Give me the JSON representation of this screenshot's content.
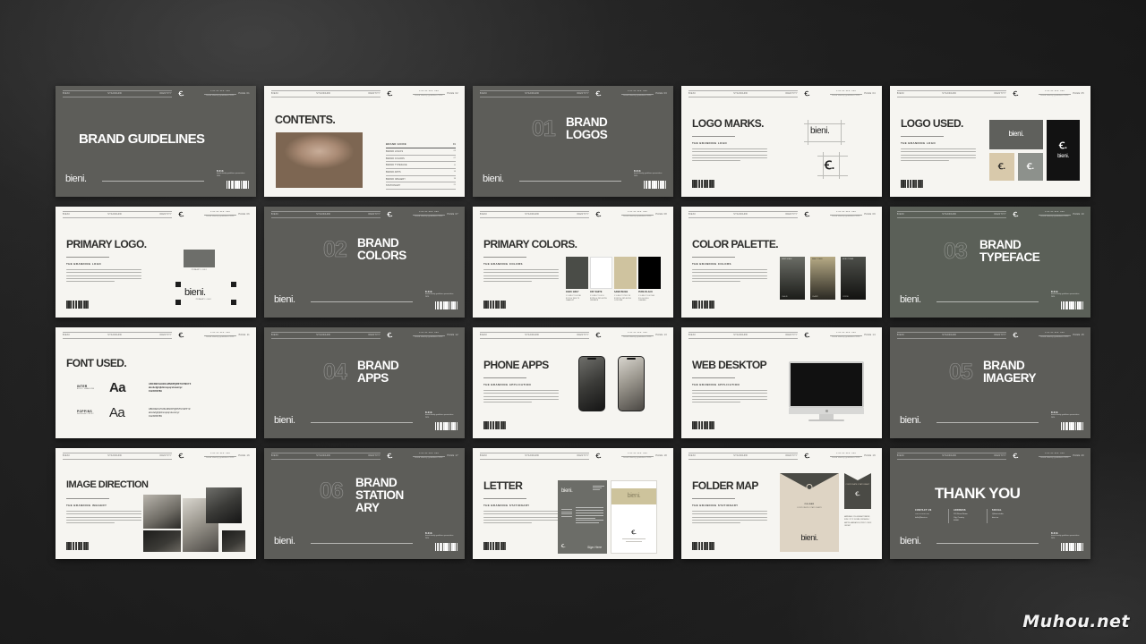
{
  "watermark": "Muhou.net",
  "brand": {
    "name": "bieni.",
    "mark": "Ꞓ.",
    "tagline": "BRAND GUIDELINES"
  },
  "header": {
    "nav": [
      "BIENI",
      "STANDARD",
      "IDENTITY"
    ],
    "meta_line1": "V.01 01 DIS. 000",
    "meta_line2": "brand identity guidelines 2024",
    "page_prefix": "PAGE"
  },
  "footer_meta": {
    "title": "B.R.D.",
    "sub": "brand identity guidelines presentation 2024"
  },
  "slides": [
    {
      "id": "brand-guidelines",
      "type": "cover",
      "theme": "dark",
      "page": "PAGE 01",
      "title": "BRAND GUIDELINES",
      "brand": "bieni."
    },
    {
      "id": "contents",
      "type": "contents",
      "theme": "light",
      "page": "PAGE 02",
      "title": "CONTENTS.",
      "toc_head": {
        "label": "BRAND GUIDE",
        "page": "01"
      },
      "toc": [
        {
          "label": "BRAND LOGOS",
          "page": "03"
        },
        {
          "label": "BRAND COLORS",
          "page": "07"
        },
        {
          "label": "BRAND TYPEFACE",
          "page": "11"
        },
        {
          "label": "BRAND APPS",
          "page": "14"
        },
        {
          "label": "BRAND IMAGERY",
          "page": "18"
        },
        {
          "label": "STATIONARY",
          "page": "21"
        }
      ]
    },
    {
      "id": "brand-logos",
      "type": "section",
      "theme": "dark",
      "page": "PAGE 03",
      "number": "01",
      "title_l1": "BRAND",
      "title_l2": "LOGOS",
      "brand": "bieni."
    },
    {
      "id": "logo-marks",
      "type": "content",
      "theme": "light",
      "page": "PAGE 04",
      "title": "LOGO MARKS.",
      "kicker": "THE BRANDING LOGO",
      "wordmark": "bieni.",
      "monogram": "Ꞓ."
    },
    {
      "id": "logo-used",
      "type": "content",
      "theme": "light",
      "page": "PAGE 05",
      "title": "LOGO USED.",
      "kicker": "THE BRANDING LOGO",
      "swatch_colors": [
        "#5f605c",
        "#d8c9ab",
        "#8d918c",
        "#121212"
      ],
      "wordmark": "bieni.",
      "monogram": "Ꞓ."
    },
    {
      "id": "primary-logo",
      "type": "content",
      "theme": "light",
      "page": "PAGE 06",
      "title": "PRIMARY LOGO.",
      "kicker": "THE BRANDING LOGO",
      "wordmark": "bieni.",
      "caption_a": "PRIMARY LOGO",
      "caption_b": "PRIMARY LOGO"
    },
    {
      "id": "brand-colors",
      "type": "section",
      "theme": "dark",
      "page": "PAGE 07",
      "number": "02",
      "title_l1": "BRAND",
      "title_l2": "COLORS",
      "brand": "bieni."
    },
    {
      "id": "primary-colors",
      "type": "colors",
      "theme": "light",
      "page": "PAGE 08",
      "title": "PRIMARY COLORS.",
      "kicker": "THE BRANDING COLORS",
      "swatches": [
        {
          "name": "DARK GREY",
          "hex": "#4A4C47",
          "cmyk": "C 0 M 0 Y 0 K 80",
          "rgb": "R 74 G 76 B 71"
        },
        {
          "name": "OFF WHITE",
          "hex": "#FFFFFF",
          "cmyk": "C 0 M 0 Y 0 K 0",
          "rgb": "R 255 G 255 B 255"
        },
        {
          "name": "SAND BEIGE",
          "hex": "#CFC39F",
          "cmyk": "C 0 M 4 Y 23 K 19",
          "rgb": "R 207 G 195 B 159"
        },
        {
          "name": "PURE BLACK",
          "hex": "#000000",
          "cmyk": "C 0 M 0 Y 0 K 100",
          "rgb": "R 0 G 0 B 0"
        }
      ]
    },
    {
      "id": "color-palette",
      "type": "palette",
      "theme": "light",
      "page": "PAGE 09",
      "title": "COLOR PALETTE.",
      "kicker": "THE BRANDING COLORS",
      "cards": [
        {
          "label": "GREY SCALE",
          "top": "#6b6d66",
          "bottom": "#1b1c19"
        },
        {
          "label": "SAND TONES",
          "top": "#b7ab86",
          "bottom": "#2a2822"
        },
        {
          "label": "MONO TONES",
          "top": "#4d4f4a",
          "bottom": "#121210"
        }
      ]
    },
    {
      "id": "brand-typeface",
      "type": "section",
      "theme": "olive",
      "page": "PAGE 10",
      "number": "03",
      "title_l1": "BRAND",
      "title_l2": "TYPEFACE",
      "brand": "bieni."
    },
    {
      "id": "font-used",
      "type": "fonts",
      "theme": "light",
      "page": "PAGE 11",
      "title": "FONT USED.",
      "fonts": [
        {
          "name": "INTER",
          "sub": "BOLD / HEADLINE",
          "sample": "Aa",
          "weight": "bold",
          "glyph_upper": "ABCDEFGHIJKLMNOPQRSTUVWXYZ",
          "glyph_lower": "abcdefghijklmnopqrstuvwxyz",
          "glyph_nums": "0123456789"
        },
        {
          "name": "POPPINS",
          "sub": "REGULAR / BODY",
          "sample": "Aa",
          "weight": "regular",
          "glyph_upper": "ABCDEFGHIJKLMNOPQRSTUVWXYZ",
          "glyph_lower": "abcdefghijklmnopqrstuvwxyz",
          "glyph_nums": "0123456789"
        }
      ]
    },
    {
      "id": "brand-apps",
      "type": "section",
      "theme": "dark",
      "page": "PAGE 12",
      "number": "04",
      "title_l1": "BRAND",
      "title_l2": "APPS",
      "brand": "bieni."
    },
    {
      "id": "phone-apps",
      "type": "content",
      "theme": "light",
      "page": "PAGE 13",
      "title": "PHONE APPS",
      "kicker": "THE BRANDING APPLICATION"
    },
    {
      "id": "web-desktop",
      "type": "content",
      "theme": "light",
      "page": "PAGE 14",
      "title": "WEB DESKTOP",
      "kicker": "THE BRANDING APPLICATION"
    },
    {
      "id": "brand-imagery",
      "type": "section",
      "theme": "dark",
      "page": "PAGE 15",
      "number": "05",
      "title_l1": "BRAND",
      "title_l2": "IMAGERY",
      "brand": "bieni."
    },
    {
      "id": "image-direction",
      "type": "content",
      "theme": "light",
      "page": "PAGE 16",
      "title": "IMAGE DIRECTION",
      "kicker": "THE BRANDING IMAGERY"
    },
    {
      "id": "brand-stationary",
      "type": "section",
      "theme": "dark",
      "page": "PAGE 17",
      "number": "06",
      "title_l1": "BRAND",
      "title_l2": "STATION",
      "title_l3": "ARY",
      "brand": "bieni."
    },
    {
      "id": "letter",
      "type": "content",
      "theme": "light",
      "page": "PAGE 18",
      "title": "LETTER",
      "kicker": "THE BRANDING STATIONARY",
      "letter_brand": "bieni.",
      "signature": "Sign Here"
    },
    {
      "id": "folder-map",
      "type": "content",
      "theme": "light",
      "page": "PAGE 19",
      "title": "FOLDER MAP",
      "kicker": "THE BRANDING STATIONARY",
      "folder_brand": "bieni.",
      "env_label": "FOLDER",
      "env_sub": "CORPORATE STATIONARY",
      "specs": "MATERIAL / 250 GSM ART PAPER, SIZE / 227 X 124 MM, FINISHING / MATTE LAMINATION, PRINT / CMYK OFFSET"
    },
    {
      "id": "thank-you",
      "type": "cover",
      "theme": "dark",
      "page": "PAGE 20",
      "title": "THANK YOU",
      "brand": "bieni.",
      "contacts": [
        {
          "head": "CONTACT US",
          "lines": "+00 123 456 789\nhello@bieni.co"
        },
        {
          "head": "ADDRESS",
          "lines": "124 Street Name\nCity, Country\n00000"
        },
        {
          "head": "SOCIAL",
          "lines": "@bieni.studio\nbieni.co"
        }
      ]
    }
  ]
}
